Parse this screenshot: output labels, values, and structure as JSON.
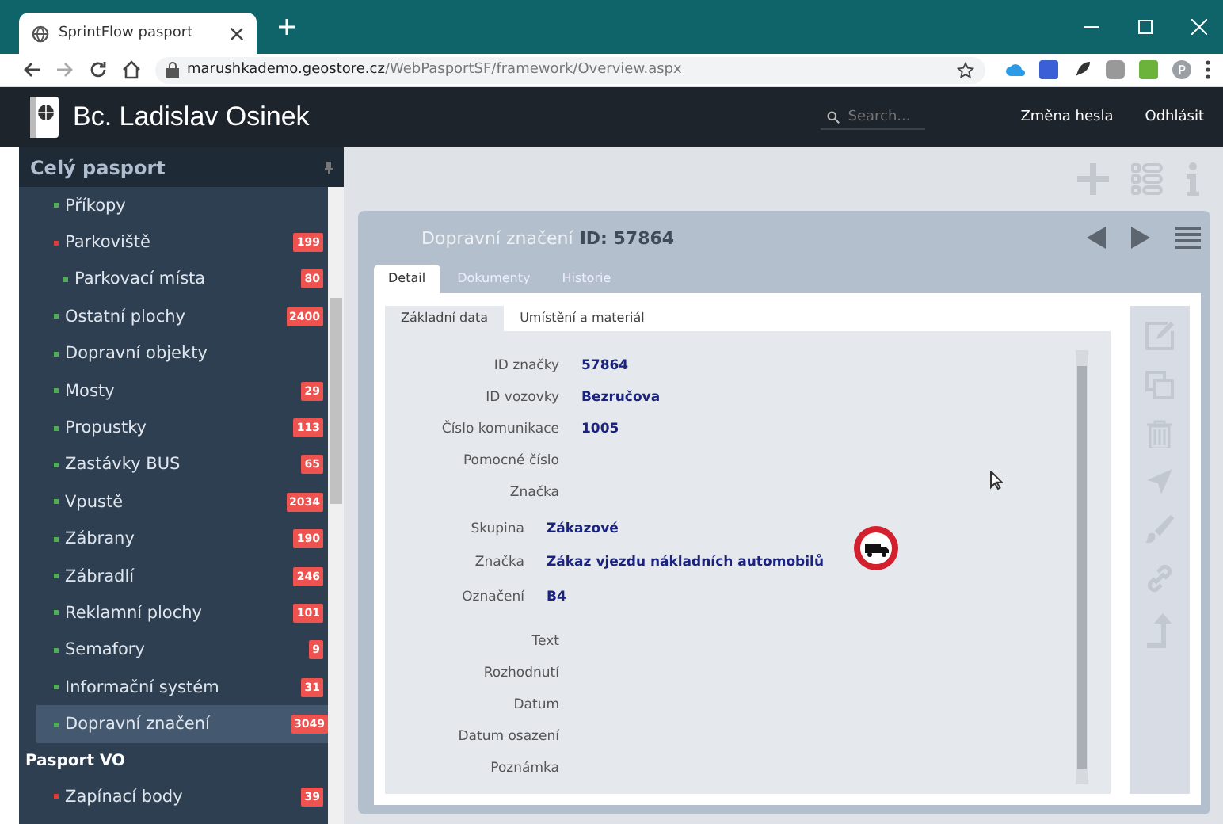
{
  "browser": {
    "tab_title": "SprintFlow pasport",
    "url_host": "marushkademo.geostore.cz",
    "url_path": "/WebPasportSF/framework/Overview.aspx",
    "profile": "P"
  },
  "header": {
    "user": "Bc. Ladislav Osinek",
    "search_placeholder": "Search...",
    "links": [
      "Změna hesla",
      "Odhlásit"
    ]
  },
  "sidebar": {
    "title": "Celý pasport",
    "items": [
      {
        "label": "Příkopy",
        "color": "#4caf50",
        "selected": false,
        "sub": false
      },
      {
        "label": "Parkoviště",
        "count": "199",
        "color": "#e53935",
        "selected": false,
        "sub": false
      },
      {
        "label": "Parkovací místa",
        "count": "80",
        "color": "#4caf50",
        "selected": false,
        "sub": true
      },
      {
        "label": "Ostatní plochy",
        "count": "2400",
        "color": "#4caf50",
        "selected": false,
        "sub": false
      },
      {
        "label": "Dopravní objekty",
        "color": "#4caf50",
        "selected": false,
        "sub": false
      },
      {
        "label": "Mosty",
        "count": "29",
        "color": "#4caf50",
        "selected": false,
        "sub": false
      },
      {
        "label": "Propustky",
        "count": "113",
        "color": "#4caf50",
        "selected": false,
        "sub": false
      },
      {
        "label": "Zastávky BUS",
        "count": "65",
        "color": "#4caf50",
        "selected": false,
        "sub": false
      },
      {
        "label": "Vpustě",
        "count": "2034",
        "color": "#4caf50",
        "selected": false,
        "sub": false
      },
      {
        "label": "Zábrany",
        "count": "190",
        "color": "#4caf50",
        "selected": false,
        "sub": false
      },
      {
        "label": "Zábradlí",
        "count": "246",
        "color": "#4caf50",
        "selected": false,
        "sub": false
      },
      {
        "label": "Reklamní plochy",
        "count": "101",
        "color": "#4caf50",
        "selected": false,
        "sub": false
      },
      {
        "label": "Semafory",
        "count": "9",
        "color": "#4caf50",
        "selected": false,
        "sub": false
      },
      {
        "label": "Informační systém",
        "count": "31",
        "color": "#4caf50",
        "selected": false,
        "sub": false
      },
      {
        "label": "Dopravní značení",
        "count": "3049",
        "color": "#4caf50",
        "selected": true,
        "sub": false
      }
    ],
    "section": "Pasport VO",
    "section_items": [
      {
        "label": "Zapínací body",
        "count": "39",
        "color": "#e53935",
        "selected": false,
        "sub": false
      }
    ]
  },
  "panel": {
    "title": "Dopravní značení",
    "id": "ID: 57864",
    "tabs": [
      {
        "label": "Detail",
        "selected": true
      },
      {
        "label": "Dokumenty",
        "selected": false
      },
      {
        "label": "Historie",
        "selected": false
      }
    ],
    "subtabs": [
      {
        "label": "Základní data",
        "selected": true
      },
      {
        "label": "Umístění a materiál",
        "selected": false
      }
    ],
    "fields": [
      {
        "label": "ID značky",
        "value": "57864"
      },
      {
        "label": "ID vozovky",
        "value": "Bezručova"
      },
      {
        "label": "Číslo komunikace",
        "value": "1005"
      },
      {
        "label": "Pomocné číslo"
      },
      {
        "label": "Značka"
      }
    ],
    "sign_fields": [
      {
        "label": "Skupina",
        "value": "Zákazové"
      },
      {
        "label": "Značka",
        "value": "Zákaz vjezdu nákladních automobilů"
      },
      {
        "label": "Označení",
        "value": "B4"
      }
    ],
    "more_fields": [
      {
        "label": "Text"
      },
      {
        "label": "Rozhodnutí"
      },
      {
        "label": "Datum"
      },
      {
        "label": "Datum osazení"
      },
      {
        "label": "Poznámka"
      }
    ]
  }
}
